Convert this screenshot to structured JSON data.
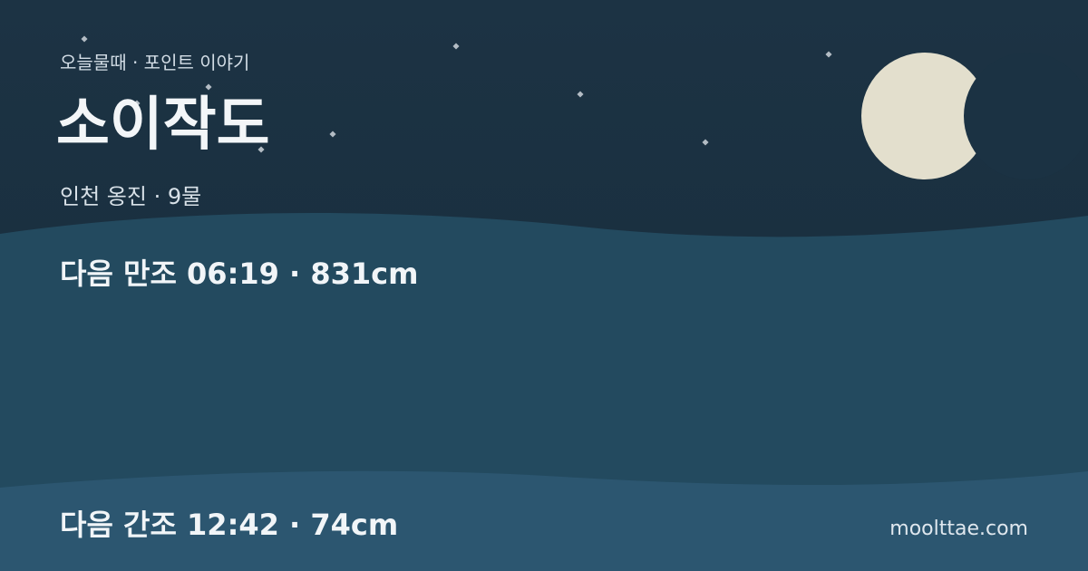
{
  "header": {
    "brand": "오늘물때 · 포인트 이야기",
    "title": "소이작도",
    "subtitle": "인천 옹진 · 9물"
  },
  "tides": {
    "high": "다음 만조 06:19 · 831cm",
    "low": "다음 간조 12:42 · 74cm"
  },
  "footer": {
    "site": "moolttae.com"
  },
  "colors": {
    "sky": "#1b2f40",
    "sea_upper": "#234a5f",
    "sea_lower": "#2c5670",
    "moon": "#e3dfcd",
    "text": "#f1f5f8"
  },
  "icons": {
    "moon": "crescent-moon-icon",
    "stars": "star-icon"
  }
}
